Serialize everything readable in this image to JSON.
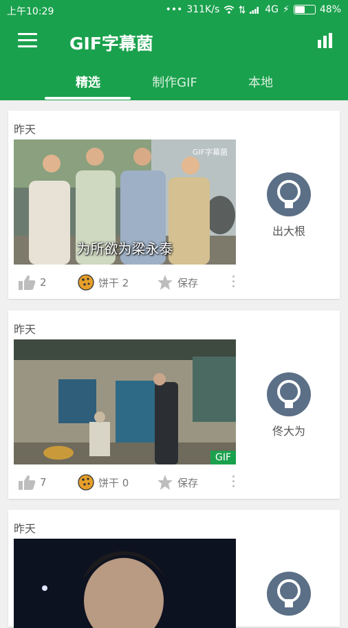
{
  "status_bar": {
    "time": "上午10:29",
    "dots": "•••",
    "speed": "311K/s",
    "network": "4G",
    "battery": "48%",
    "battery_fill": 0.48
  },
  "app_bar": {
    "title": "GIF字幕菌"
  },
  "tabs": [
    {
      "label": "精选",
      "active": true
    },
    {
      "label": "制作GIF",
      "active": false
    },
    {
      "label": "本地",
      "active": false
    }
  ],
  "colors": {
    "brand": "#1aa14d",
    "avatar": "#5b6f86",
    "cookie": "#e69f2a"
  },
  "feed": [
    {
      "date": "昨天",
      "watermark": "GIF字幕菌",
      "subtitle": "为所欲为梁永泰",
      "gif_badge": "",
      "likes": "2",
      "cookie_label": "饼干 2",
      "save_label": "保存",
      "author": "出大根"
    },
    {
      "date": "昨天",
      "watermark": "",
      "subtitle": "",
      "gif_badge": "GIF",
      "likes": "7",
      "cookie_label": "饼干 0",
      "save_label": "保存",
      "author": "佟大为"
    },
    {
      "date": "昨天",
      "watermark": "",
      "subtitle": "",
      "gif_badge": "",
      "likes": "",
      "cookie_label": "",
      "save_label": "",
      "author": ""
    }
  ]
}
